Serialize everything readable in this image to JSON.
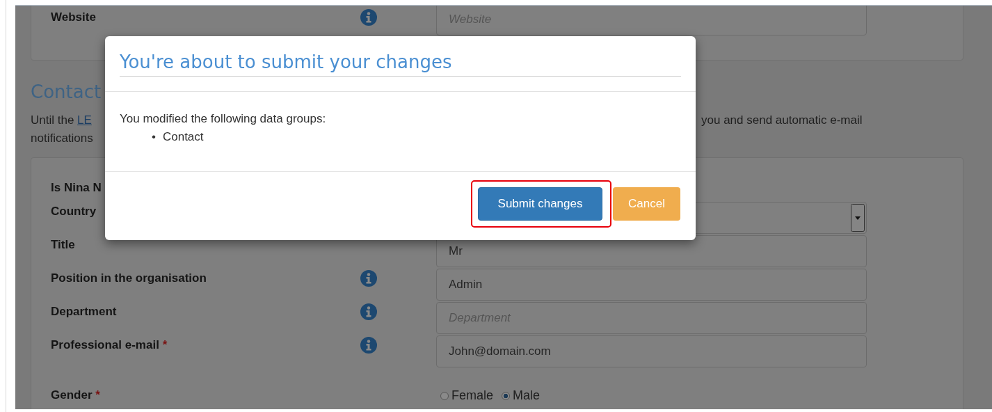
{
  "website_panel": {
    "rows": [
      {
        "kind": "text",
        "label": "Website",
        "info": true,
        "placeholder": "Website"
      }
    ]
  },
  "contact_section": {
    "heading": "Contact",
    "intro": {
      "prefix": "Until the",
      "link": "LE",
      "line_2": "notifications",
      "continuation": "you and send automatic e-mail"
    }
  },
  "contact_panel": {
    "rows": [
      {
        "kind": "label",
        "label": "Is Nina N"
      },
      {
        "kind": "select",
        "label": "Country",
        "info": false
      },
      {
        "kind": "text",
        "label": "Title",
        "info": false,
        "value": "Mr"
      },
      {
        "kind": "text",
        "label": "Position in the organisation",
        "info": true,
        "value": "Admin"
      },
      {
        "kind": "text",
        "label": "Department",
        "info": true,
        "placeholder": "Department"
      },
      {
        "kind": "text",
        "label": "Professional e-mail",
        "required_marker": "*",
        "info": true,
        "value": "John@domain.com"
      },
      {
        "kind": "radio",
        "label": "Gender",
        "required_marker": "*",
        "options": [
          {
            "label": "Female",
            "selected": false
          },
          {
            "label": "Male",
            "selected": true
          }
        ]
      }
    ]
  },
  "dialog": {
    "title": "You're about to submit your changes",
    "message": "You modified the following data groups:",
    "list_marker": "•",
    "groups": [
      "Contact"
    ],
    "buttons": [
      {
        "label": "Submit changes",
        "kind": "primary",
        "highlighted": true
      },
      {
        "label": "Cancel",
        "kind": "warning",
        "highlighted": false
      }
    ]
  }
}
